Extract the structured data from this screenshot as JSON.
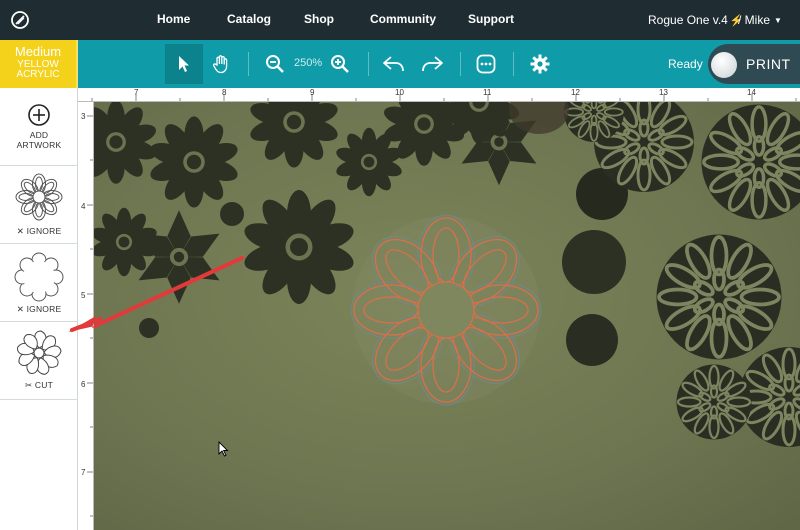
{
  "nav": {
    "links": [
      "Home",
      "Catalog",
      "Shop",
      "Community",
      "Support"
    ],
    "device": "Rogue One v.4",
    "user": "/  Mike"
  },
  "material": {
    "thickness": "Medium",
    "color": "YELLOW",
    "type": "ACRYLIC",
    "accent": "#f4d11a"
  },
  "toolbar": {
    "zoom": "250%",
    "status": "Ready",
    "print_label": "PRINT",
    "accent": "#0f9ca8",
    "icons": [
      "pointer-icon",
      "hand-icon",
      "zoom-out-icon",
      "zoom-in-icon",
      "undo-icon",
      "redo-icon",
      "more-icon",
      "gear-icon"
    ]
  },
  "sidebar": {
    "add_label_1": "ADD",
    "add_label_2": "ARTWORK",
    "items": [
      {
        "action": "IGNORE",
        "icon": "x-icon"
      },
      {
        "action": "IGNORE",
        "icon": "x-icon"
      },
      {
        "action": "CUT",
        "icon": "scissors-icon"
      }
    ]
  },
  "ruler": {
    "top": [
      "7",
      "8",
      "9",
      "10",
      "11",
      "12",
      "13",
      "14"
    ],
    "left": [
      "3",
      "4",
      "5",
      "6",
      "7"
    ]
  }
}
